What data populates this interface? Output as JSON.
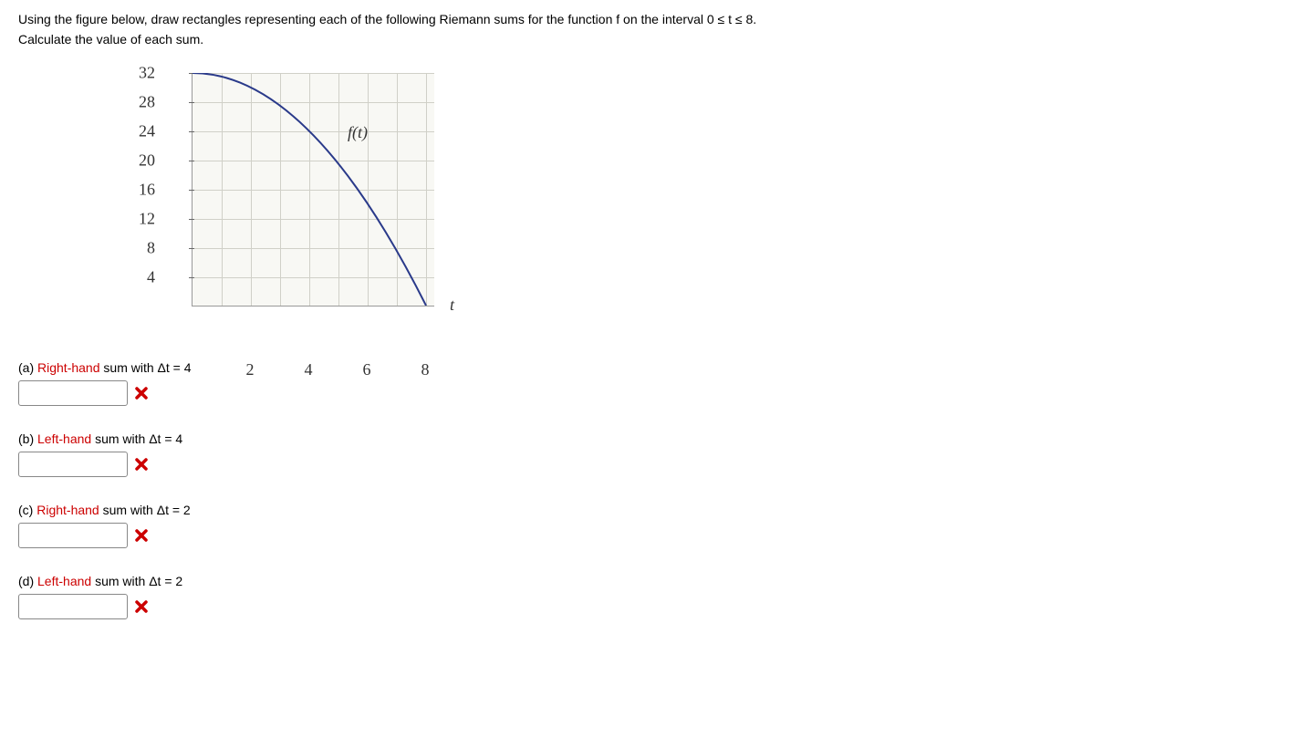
{
  "instructions": {
    "line1": "Using the figure below, draw rectangles representing each of the following Riemann sums for the function f on the interval 0 ≤ t ≤ 8.",
    "line2": "Calculate the value of each sum."
  },
  "chart_data": {
    "type": "line",
    "title": "",
    "xlabel": "t",
    "ylabel": "",
    "fn_label": "f(t)",
    "xlim": [
      0,
      8
    ],
    "ylim": [
      0,
      32
    ],
    "x_ticks": [
      2,
      4,
      6,
      8
    ],
    "y_ticks": [
      4,
      8,
      12,
      16,
      20,
      24,
      28,
      32
    ],
    "series": [
      {
        "name": "f(t)",
        "x": [
          0,
          1,
          2,
          3,
          4,
          5,
          6,
          7,
          8
        ],
        "y": [
          32,
          31.5,
          30,
          27.5,
          24,
          19.5,
          14,
          7.5,
          0
        ]
      }
    ]
  },
  "questions": [
    {
      "label": "(a)",
      "hand": "Right-hand",
      "rest": " sum with Δt = 4",
      "value": ""
    },
    {
      "label": "(b)",
      "hand": "Left-hand",
      "rest": " sum with Δt = 4",
      "value": ""
    },
    {
      "label": "(c)",
      "hand": "Right-hand",
      "rest": " sum with Δt = 2",
      "value": ""
    },
    {
      "label": "(d)",
      "hand": "Left-hand",
      "rest": " sum with Δt = 2",
      "value": ""
    }
  ]
}
